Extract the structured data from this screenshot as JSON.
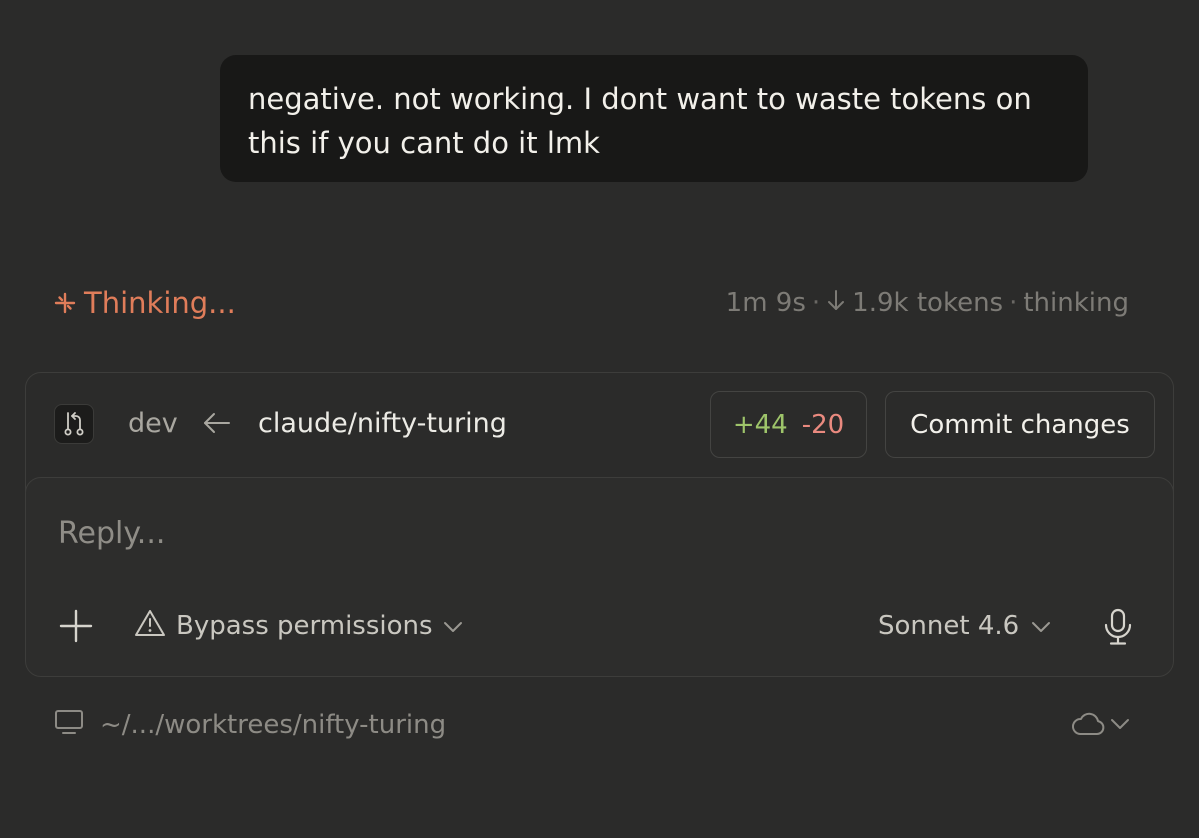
{
  "message": {
    "text": "negative. not working. I dont want to waste tokens on this if you cant do it lmk"
  },
  "status": {
    "label": "Thinking...",
    "elapsed": "1m 9s",
    "tokens": "1.9k tokens",
    "mode": "thinking",
    "accent_color": "#e07d5a"
  },
  "branch": {
    "icon": "git-branch-icon",
    "base": "dev",
    "head": "claude/nifty-turing",
    "additions": "+44",
    "deletions": "-20",
    "commit_label": "Commit changes"
  },
  "composer": {
    "placeholder": "Reply...",
    "permission_label": "Bypass permissions",
    "model_label": "Sonnet 4.6"
  },
  "footer": {
    "path": "~/.../worktrees/nifty-turing"
  }
}
